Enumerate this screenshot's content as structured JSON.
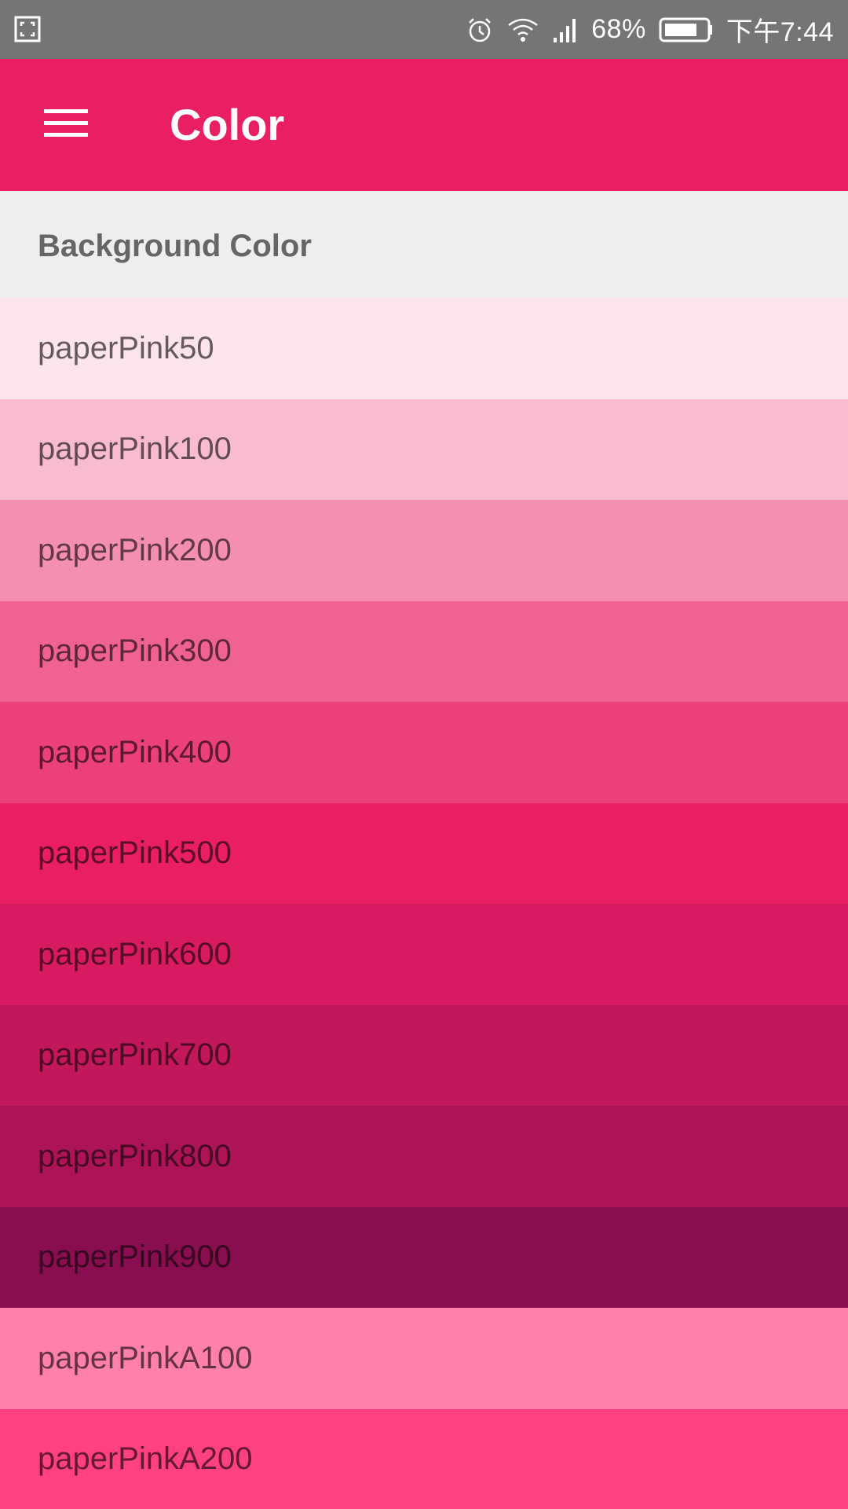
{
  "status_bar": {
    "battery_percent": "68%",
    "time": "下午7:44",
    "icons": [
      "screenshot-icon",
      "alarm-icon",
      "wifi-icon",
      "signal-icon",
      "battery-icon"
    ]
  },
  "app_bar": {
    "title": "Color",
    "menu_icon": "hamburger-menu-icon",
    "color": "#e91e63"
  },
  "section": {
    "header": "Background Color"
  },
  "colors": [
    {
      "label": "paperPink50",
      "color": "#fce4ec"
    },
    {
      "label": "paperPink100",
      "color": "#f8bbd0"
    },
    {
      "label": "paperPink200",
      "color": "#f48fb1"
    },
    {
      "label": "paperPink300",
      "color": "#f06292"
    },
    {
      "label": "paperPink400",
      "color": "#ec407a"
    },
    {
      "label": "paperPink500",
      "color": "#e91e63"
    },
    {
      "label": "paperPink600",
      "color": "#d81b60"
    },
    {
      "label": "paperPink700",
      "color": "#c2185b"
    },
    {
      "label": "paperPink800",
      "color": "#ad1457"
    },
    {
      "label": "paperPink900",
      "color": "#880e4f"
    },
    {
      "label": "paperPinkA100",
      "color": "#ff80ab"
    },
    {
      "label": "paperPinkA200",
      "color": "#ff4081"
    }
  ]
}
